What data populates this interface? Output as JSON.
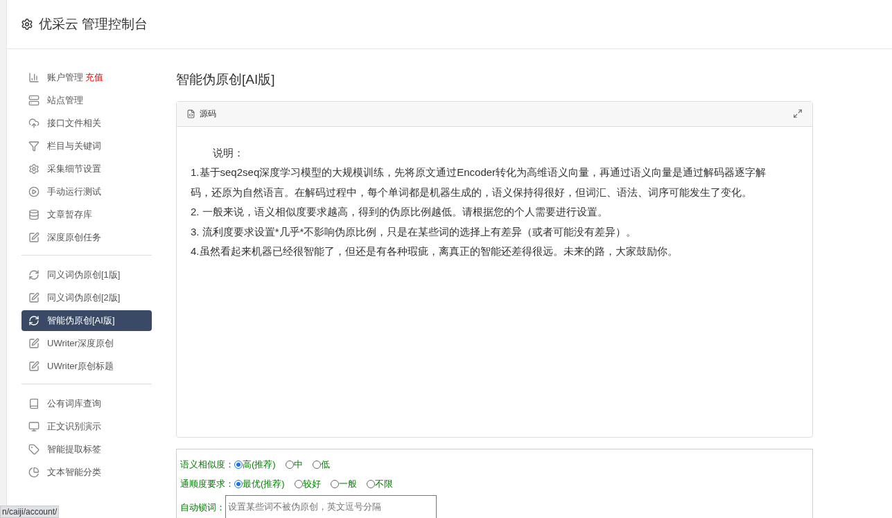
{
  "header": {
    "title": "优采云 管理控制台"
  },
  "sidebar": {
    "groups": [
      [
        {
          "label": "账户管理",
          "badge": "充值",
          "selected": false
        },
        {
          "label": "站点管理",
          "selected": false
        },
        {
          "label": "接口文件相关",
          "selected": false
        },
        {
          "label": "栏目与关键词",
          "selected": false
        },
        {
          "label": "采集细节设置",
          "selected": false
        },
        {
          "label": "手动运行测试",
          "selected": false
        },
        {
          "label": "文章暂存库",
          "selected": false
        },
        {
          "label": "深度原创任务",
          "selected": false
        }
      ],
      [
        {
          "label": "同义词伪原创[1版]",
          "selected": false
        },
        {
          "label": "同义词伪原创[2版]",
          "selected": false
        },
        {
          "label": "智能伪原创[AI版]",
          "selected": true
        },
        {
          "label": "UWriter深度原创",
          "selected": false
        },
        {
          "label": "UWriter原创标题",
          "selected": false
        }
      ],
      [
        {
          "label": "公有词库查询",
          "selected": false
        },
        {
          "label": "正文识别演示",
          "selected": false
        },
        {
          "label": "智能提取标签",
          "selected": false
        },
        {
          "label": "文本智能分类",
          "selected": false
        }
      ]
    ]
  },
  "main": {
    "title": "智能伪原创[AI版]",
    "editor": {
      "tab": "源码",
      "lines": [
        "说明：",
        "1.基于seq2seq深度学习模型的大规模训练，先将原文通过Encoder转化为高维语义向量，再通过语义向量是通过解码器逐字解码，还原为自然语言。在解码过程中，每个单词都是机器生成的，语义保持得很好，但词汇、语法、词序可能发生了变化。",
        "2. 一般来说，语义相似度要求越高，得到的伪原比例越低。请根据您的个人需要进行设置。",
        "3. 流利度要求设置*几乎*不影响伪原比例，只是在某些词的选择上有差异（或者可能没有差异）。",
        "4.虽然看起来机器已经很智能了，但还是有各种瑕疵，离真正的智能还差得很远。未来的路，大家鼓励你。"
      ]
    },
    "form": {
      "radio_groups": [
        {
          "label": "语义相似度：",
          "options": [
            {
              "label": "高(推荐)",
              "selected": true
            },
            {
              "label": "中",
              "selected": false
            },
            {
              "label": "低",
              "selected": false
            }
          ]
        },
        {
          "label": "通顺度要求：",
          "options": [
            {
              "label": "最优(推荐)",
              "selected": true
            },
            {
              "label": "较好",
              "selected": false
            },
            {
              "label": "一般",
              "selected": false
            },
            {
              "label": "不限",
              "selected": false
            }
          ]
        }
      ],
      "lock_words": {
        "label": "自动锁词：",
        "placeholder": "设置某些词不被伪原创，英文逗号分隔"
      }
    }
  },
  "status_bar": {
    "url": "n/caiji/account/"
  }
}
